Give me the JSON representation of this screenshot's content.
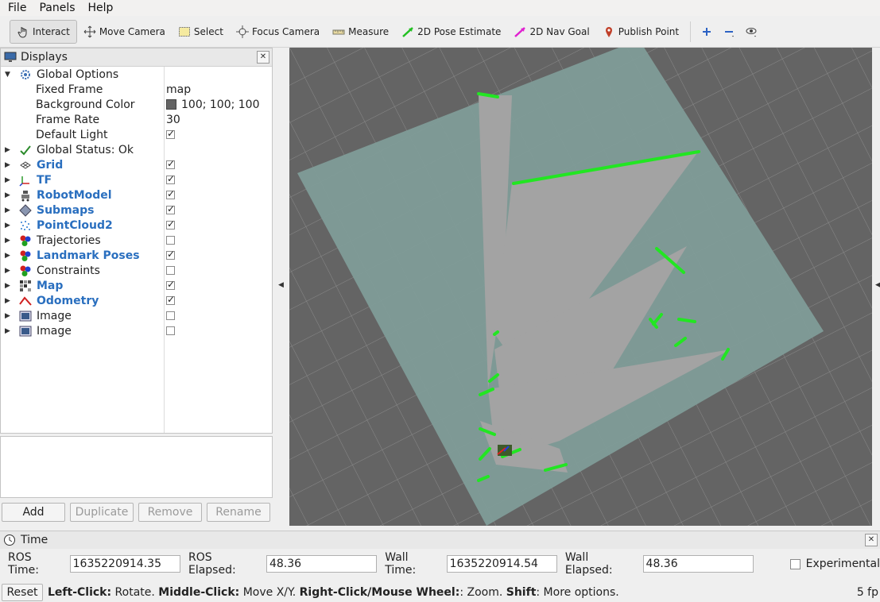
{
  "menu": [
    "File",
    "Panels",
    "Help"
  ],
  "toolbar": {
    "interact": "Interact",
    "move_camera": "Move Camera",
    "select": "Select",
    "focus_camera": "Focus Camera",
    "measure": "Measure",
    "pose_estimate": "2D Pose Estimate",
    "nav_goal": "2D Nav Goal",
    "publish_point": "Publish Point"
  },
  "displays": {
    "title": "Displays",
    "global_options": "Global Options",
    "fixed_frame_label": "Fixed Frame",
    "fixed_frame_value": "map",
    "background_color_label": "Background Color",
    "background_color_value": "100; 100; 100",
    "frame_rate_label": "Frame Rate",
    "frame_rate_value": "30",
    "default_light_label": "Default Light",
    "global_status": "Global Status: Ok",
    "items": [
      {
        "label": "Grid",
        "checked": true
      },
      {
        "label": "TF",
        "checked": true
      },
      {
        "label": "RobotModel",
        "checked": true
      },
      {
        "label": "Submaps",
        "checked": true
      },
      {
        "label": "PointCloud2",
        "checked": true
      },
      {
        "label": "Trajectories",
        "checked": false
      },
      {
        "label": "Landmark Poses",
        "checked": true
      },
      {
        "label": "Constraints",
        "checked": false
      },
      {
        "label": "Map",
        "checked": true
      },
      {
        "label": "Odometry",
        "checked": true
      },
      {
        "label": "Image",
        "checked": false
      },
      {
        "label": "Image",
        "checked": false
      }
    ]
  },
  "buttons": {
    "add": "Add",
    "duplicate": "Duplicate",
    "remove": "Remove",
    "rename": "Rename"
  },
  "time": {
    "title": "Time",
    "ros_time_label": "ROS Time:",
    "ros_time_value": "1635220914.35",
    "ros_elapsed_label": "ROS Elapsed:",
    "ros_elapsed_value": "48.36",
    "wall_time_label": "Wall Time:",
    "wall_time_value": "1635220914.54",
    "wall_elapsed_label": "Wall Elapsed:",
    "wall_elapsed_value": "48.36",
    "experimental_label": "Experimental"
  },
  "status": {
    "reset": "Reset",
    "left_click": "Left-Click:",
    "rotate": " Rotate. ",
    "middle_click": "Middle-Click:",
    "move_xy": " Move X/Y. ",
    "right_click": "Right-Click/Mouse Wheel:",
    "zoom": ": Zoom. ",
    "shift": "Shift",
    "more": ": More options.",
    "fps": "5 fp"
  },
  "colors": {
    "map_free": "#a0a0a0",
    "map_unknown": "#7f9c98",
    "walls": "#22e622",
    "background": "#646464"
  }
}
